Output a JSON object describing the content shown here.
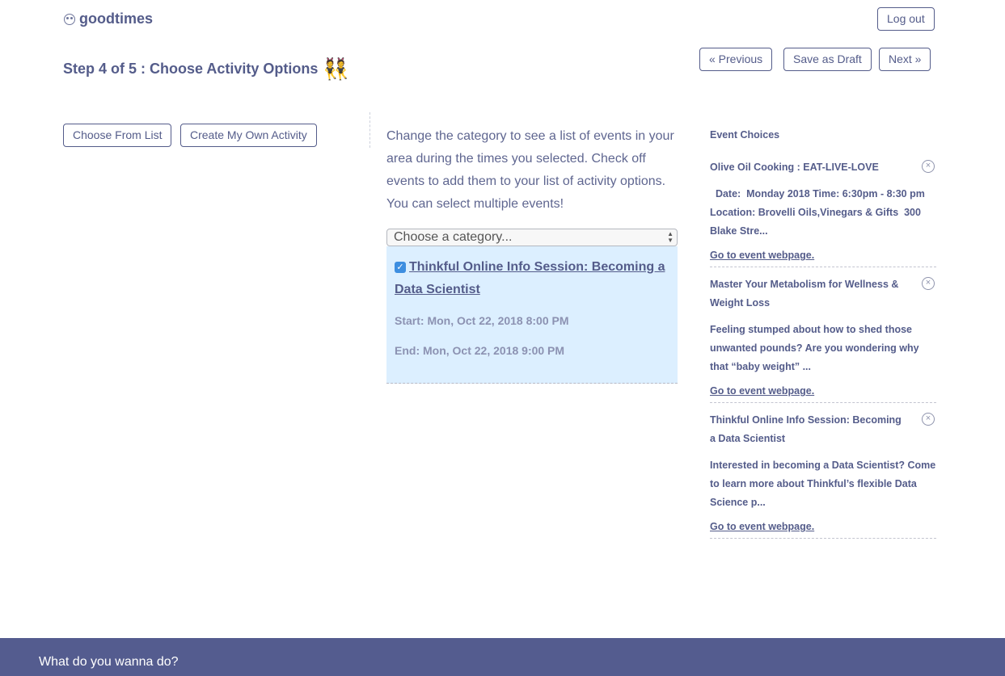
{
  "header": {
    "logo_text": "goodtimes",
    "logout_label": "Log out"
  },
  "step": {
    "title": "Step 4 of 5 : Choose Activity Options",
    "emoji": "👯",
    "prev_label": "« Previous",
    "draft_label": "Save as Draft",
    "next_label": "Next »"
  },
  "left": {
    "choose_list_label": "Choose From List",
    "create_own_label": "Create My Own Activity"
  },
  "main": {
    "intro": "Change the category to see a list of events in your area during the times you selected. Check off events to add them to your list of activity options. You can select multiple events!",
    "category_select": "Choose a category...",
    "event": {
      "checked": true,
      "title": "Thinkful Online Info Session: Becoming a Data Scientist",
      "start": "Start: Mon, Oct 22, 2018 8:00 PM",
      "end": "End: Mon, Oct 22, 2018 9:00 PM"
    }
  },
  "sidebar": {
    "heading": "Event Choices",
    "choices": [
      {
        "title": "Olive Oil Cooking : EAT-LIVE-LOVE",
        "desc": "  Date:  Monday 2018 Time: 6:30pm - 8:30 pm Location: Brovelli Oils,Vinegars & Gifts  300 Blake Stre...",
        "link": "Go to event webpage."
      },
      {
        "title": "Master Your Metabolism for Wellness & Weight Loss",
        "desc": "Feeling stumped about how to shed those unwanted pounds? Are you wondering why that “baby weight” ...",
        "link": "Go to event webpage."
      },
      {
        "title": "Thinkful Online Info Session: Becoming a Data Scientist",
        "desc": "Interested in becoming a Data Scientist? Come to learn more about Thinkful’s flexible Data Science p...",
        "link": "Go to event webpage."
      }
    ]
  },
  "footer": {
    "text": "What do you wanna do?"
  }
}
